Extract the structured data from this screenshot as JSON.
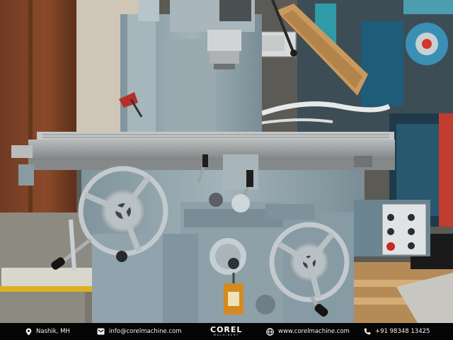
{
  "footer": {
    "location": "Nashik, MH",
    "email": "info@corelmachine.com",
    "brand": "COREL",
    "brand_sub": "MACHINERY",
    "website": "www.corelmachine.com",
    "phone": "+91 98348 13425"
  },
  "icons": {
    "location": "map-pin-icon",
    "email": "envelope-icon",
    "website": "globe-icon",
    "phone": "phone-icon"
  },
  "colors": {
    "footer_bg": "#050505",
    "footer_text": "#f2f2f2",
    "machine_body": "#8fa2ab",
    "table_steel": "#9a9c9d"
  }
}
